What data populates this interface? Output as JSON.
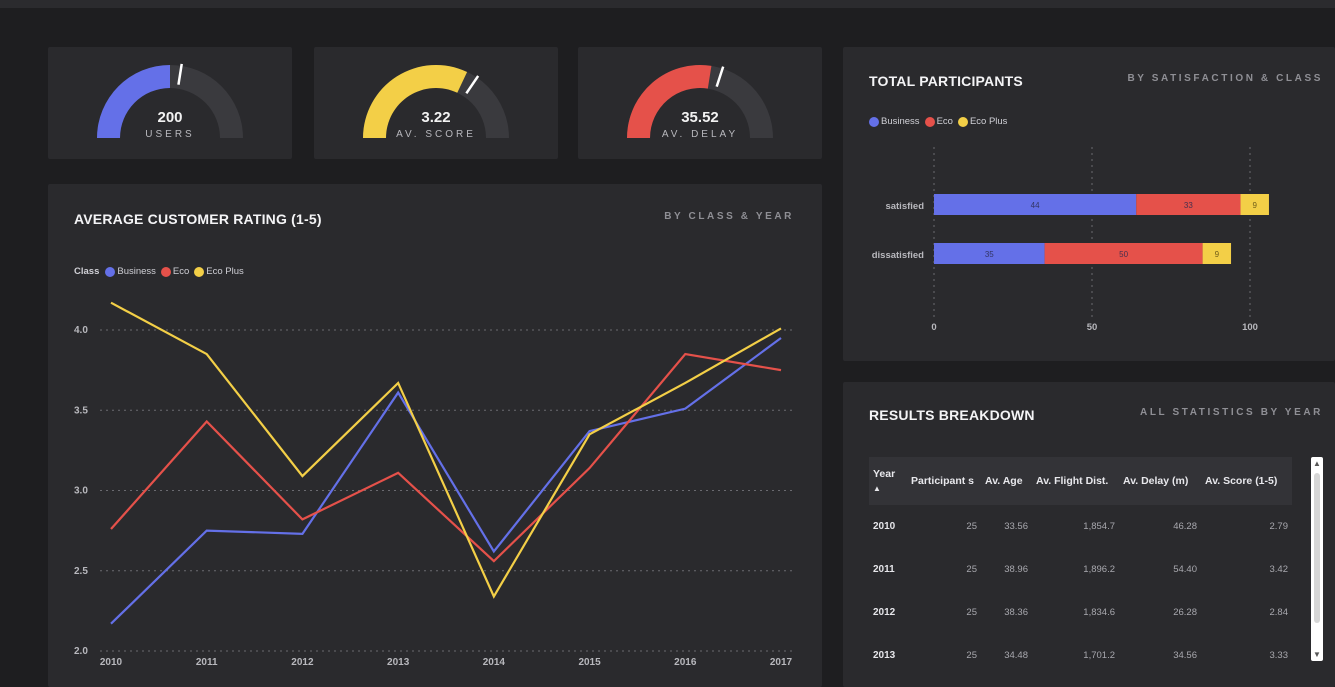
{
  "kpis": [
    {
      "value": "200",
      "label": "USERS",
      "fraction": 0.5,
      "color": "#6470e8"
    },
    {
      "value": "3.22",
      "label": "AV. SCORE",
      "fraction": 0.64,
      "color": "#f3cf47"
    },
    {
      "value": "35.52",
      "label": "AV. DELAY",
      "fraction": 0.55,
      "color": "#e5514a"
    }
  ],
  "colors": {
    "business": "#6470e8",
    "eco": "#e5514a",
    "eco_plus": "#f3cf47",
    "track": "#3a3a3e"
  },
  "line_card": {
    "title": "AVERAGE CUSTOMER RATING (1-5)",
    "subtitle": "BY CLASS & YEAR",
    "legend_title": "Class",
    "legend": [
      "Business",
      "Eco",
      "Eco Plus"
    ]
  },
  "bar_card": {
    "title": "TOTAL PARTICIPANTS",
    "subtitle": "BY SATISFACTION & CLASS",
    "legend": [
      "Business",
      "Eco",
      "Eco Plus"
    ]
  },
  "table_card": {
    "title": "RESULTS BREAKDOWN",
    "subtitle": "ALL STATISTICS BY YEAR",
    "columns": [
      "Year",
      "Participant s",
      "Av. Age",
      "Av. Flight Dist.",
      "Av. Delay (m)",
      "Av. Score (1-5)"
    ],
    "rows": [
      [
        "2010",
        "25",
        "33.56",
        "1,854.7",
        "46.28",
        "2.79"
      ],
      [
        "2011",
        "25",
        "38.96",
        "1,896.2",
        "54.40",
        "3.42"
      ],
      [
        "2012",
        "25",
        "38.36",
        "1,834.6",
        "26.28",
        "2.84"
      ],
      [
        "2013",
        "25",
        "34.48",
        "1,701.2",
        "34.56",
        "3.33"
      ]
    ]
  },
  "chart_data": [
    {
      "type": "line",
      "title": "AVERAGE CUSTOMER RATING (1-5)",
      "x": [
        "2010",
        "2011",
        "2012",
        "2013",
        "2014",
        "2015",
        "2016",
        "2017"
      ],
      "ylim": [
        2.0,
        4.0
      ],
      "yticks": [
        "2.0",
        "2.5",
        "3.0",
        "3.5",
        "4.0"
      ],
      "grid": true,
      "legend_position": "top-left",
      "series": [
        {
          "name": "Business",
          "values": [
            2.17,
            2.75,
            2.73,
            3.61,
            2.62,
            3.37,
            3.51,
            3.95
          ]
        },
        {
          "name": "Eco",
          "values": [
            2.76,
            3.43,
            2.82,
            3.11,
            2.56,
            3.14,
            3.85,
            3.75
          ]
        },
        {
          "name": "Eco Plus",
          "values": [
            4.17,
            3.85,
            3.09,
            3.67,
            2.34,
            3.35,
            3.67,
            4.01
          ]
        }
      ]
    },
    {
      "type": "bar",
      "orientation": "horizontal",
      "stacked": true,
      "title": "TOTAL PARTICIPANTS",
      "categories": [
        "satisfied",
        "dissatisfied"
      ],
      "xlim": [
        0,
        100
      ],
      "xticks": [
        "0",
        "50",
        "100"
      ],
      "series": [
        {
          "name": "Business",
          "values": [
            64,
            35
          ]
        },
        {
          "name": "Eco",
          "values": [
            33,
            50
          ]
        },
        {
          "name": "Eco Plus",
          "values": [
            9,
            9
          ]
        }
      ],
      "data_labels": [
        [
          "44",
          "33",
          "9"
        ],
        [
          "35",
          "50",
          "9"
        ]
      ]
    }
  ]
}
